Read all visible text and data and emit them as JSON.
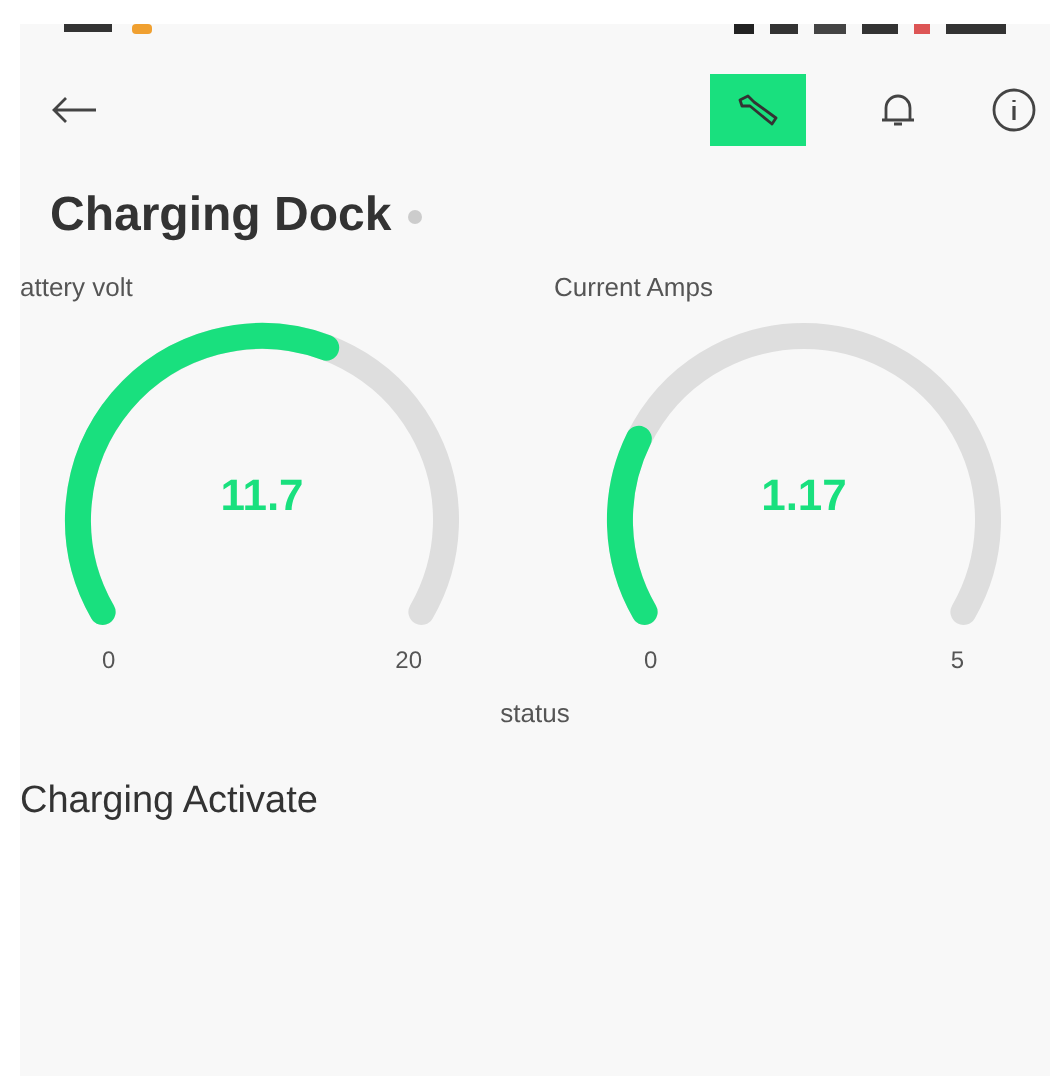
{
  "toolbar": {
    "buttons": [
      {
        "kind": "wrench",
        "selected": true
      },
      {
        "kind": "bell",
        "selected": false
      },
      {
        "kind": "info",
        "selected": false
      }
    ]
  },
  "title": "Charging Dock",
  "gauges": [
    {
      "label": "attery volt",
      "value": "11.7",
      "min": "0",
      "max": "20"
    },
    {
      "label": "Current Amps",
      "value": "1.17",
      "min": "0",
      "max": "5"
    }
  ],
  "status_label": "status",
  "section": "Charging Activate"
}
